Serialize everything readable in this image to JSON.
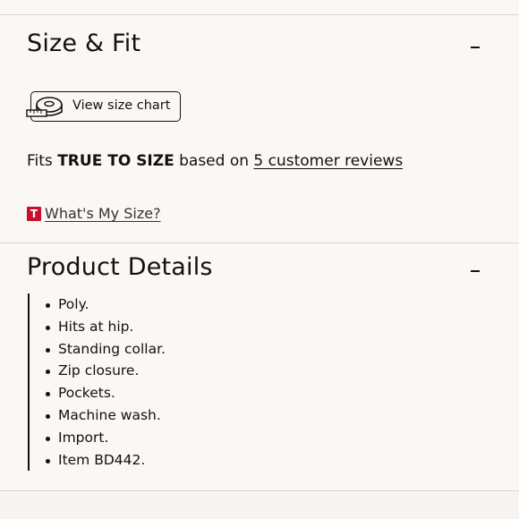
{
  "size_fit": {
    "title": "Size & Fit",
    "toggle_label": "–",
    "size_chart_button": "View size chart",
    "fits_prefix": "Fits",
    "fits_value": "TRUE TO SIZE",
    "fits_middle": "based on",
    "reviews_link": "5 customer reviews",
    "whats_my_size_badge": "T",
    "whats_my_size_link": "What's My Size?"
  },
  "product_details": {
    "title": "Product Details",
    "toggle_label": "–",
    "items": [
      "Poly.",
      "Hits at hip.",
      "Standing collar.",
      "Zip closure.",
      "Pockets.",
      "Machine wash.",
      "Import.",
      "Item BD442."
    ]
  },
  "colors": {
    "background": "#fbf7f4",
    "text": "#111111",
    "badge": "#c8102e",
    "divider": "#d9d4cf"
  }
}
